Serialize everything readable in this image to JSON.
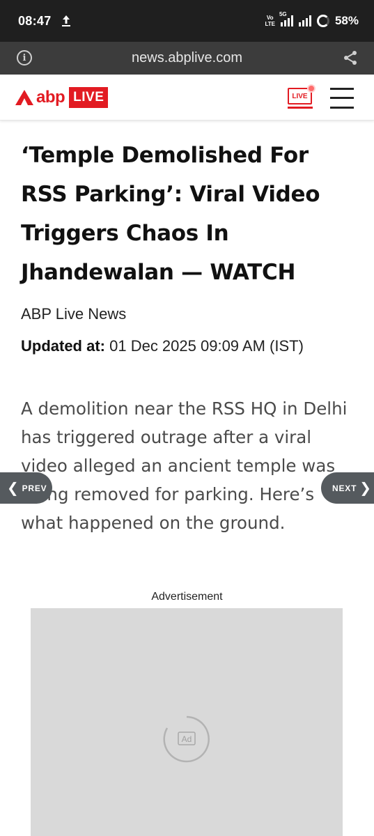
{
  "status_bar": {
    "time": "08:47",
    "volte_top": "Vo",
    "volte_bottom": "LTE",
    "network": "5G",
    "battery": "58%"
  },
  "browser": {
    "url": "news.abplive.com",
    "info_symbol": "i"
  },
  "site": {
    "logo_text": "abp",
    "logo_badge": "LIVE",
    "live_tv_label": "LIVE"
  },
  "article": {
    "headline": "‘Temple Demolished For RSS Parking’: Viral Video Triggers Chaos In Jhandewalan — WATCH",
    "byline": "ABP Live News",
    "updated_label": "Updated at:",
    "updated_value": " 01 Dec 2025 09:09 AM (IST)",
    "summary": "A demolition near the RSS HQ in Delhi has triggered outrage after a viral video alleged an ancient temple was being removed for parking. Here’s what happened on the ground."
  },
  "nav": {
    "prev_label": "PREV",
    "next_label": "NEXT"
  },
  "ad": {
    "label": "Advertisement",
    "badge": "Ad"
  },
  "colors": {
    "brand_red": "#e21b22",
    "status_bar_bg": "#1f1f1f",
    "url_bar_bg": "#3c3c3c",
    "ad_placeholder": "#d9d9d9"
  }
}
